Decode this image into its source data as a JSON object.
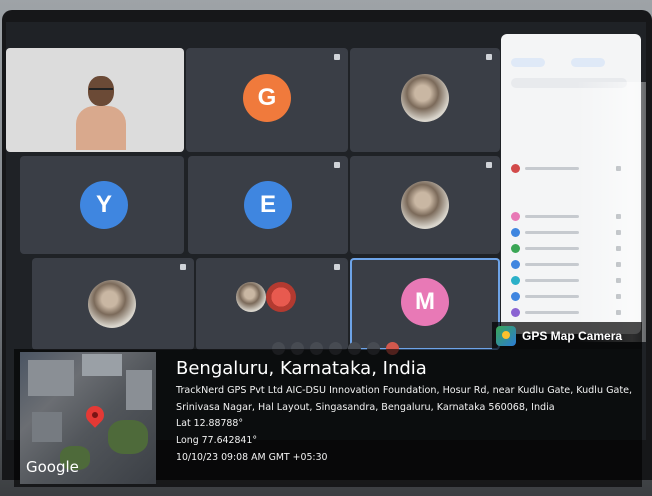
{
  "tiles": {
    "t2": {
      "initial": "G",
      "color": "#f07a3c"
    },
    "t4": {
      "initial": "Y",
      "color": "#3f86e0"
    },
    "t5": {
      "initial": "E",
      "color": "#3f86e0"
    },
    "t9": {
      "initial": "M",
      "color": "#e879b6"
    }
  },
  "badge": {
    "label": "GPS Map Camera"
  },
  "map": {
    "logo_text": "Google"
  },
  "location": {
    "title": "Bengaluru, Karnataka, India",
    "address": "TrackNerd GPS Pvt Ltd AIC-DSU Innovation Foundation, Hosur Rd, near Kudlu Gate, Kudlu Gate, Srinivasa Nagar, Hal Layout, Singasandra, Bengaluru, Karnataka 560068, India",
    "lat": "Lat 12.88788°",
    "long": "Long 77.642841°",
    "timestamp": "10/10/23 09:08 AM GMT +05:30"
  }
}
